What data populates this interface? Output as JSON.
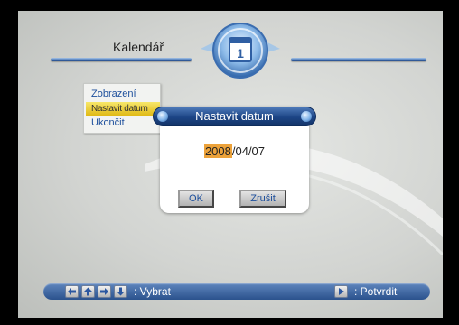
{
  "header": {
    "title": "Kalendář",
    "emblem_number": "1"
  },
  "menu": {
    "items": [
      {
        "label": "Zobrazení",
        "selected": false
      },
      {
        "label": "Nastavit datum",
        "selected": true
      },
      {
        "label": "Ukončit",
        "selected": false
      }
    ]
  },
  "dialog": {
    "title": "Nastavit datum",
    "date_year": "2008",
    "date_rest": "/04/07",
    "ok_label": "OK",
    "cancel_label": "Zrušit"
  },
  "footer": {
    "nav_icons": [
      "arrow-left-icon",
      "arrow-up-icon",
      "arrow-right-icon",
      "arrow-down-icon"
    ],
    "select_hint": ": Vybrat",
    "confirm_icon": "play-icon",
    "confirm_hint": ": Potvrdit"
  },
  "colors": {
    "accent_blue": "#1d4f9c",
    "title_bar": "#1c4485",
    "selection_yellow": "#e0b915",
    "year_highlight": "#eca23a"
  }
}
